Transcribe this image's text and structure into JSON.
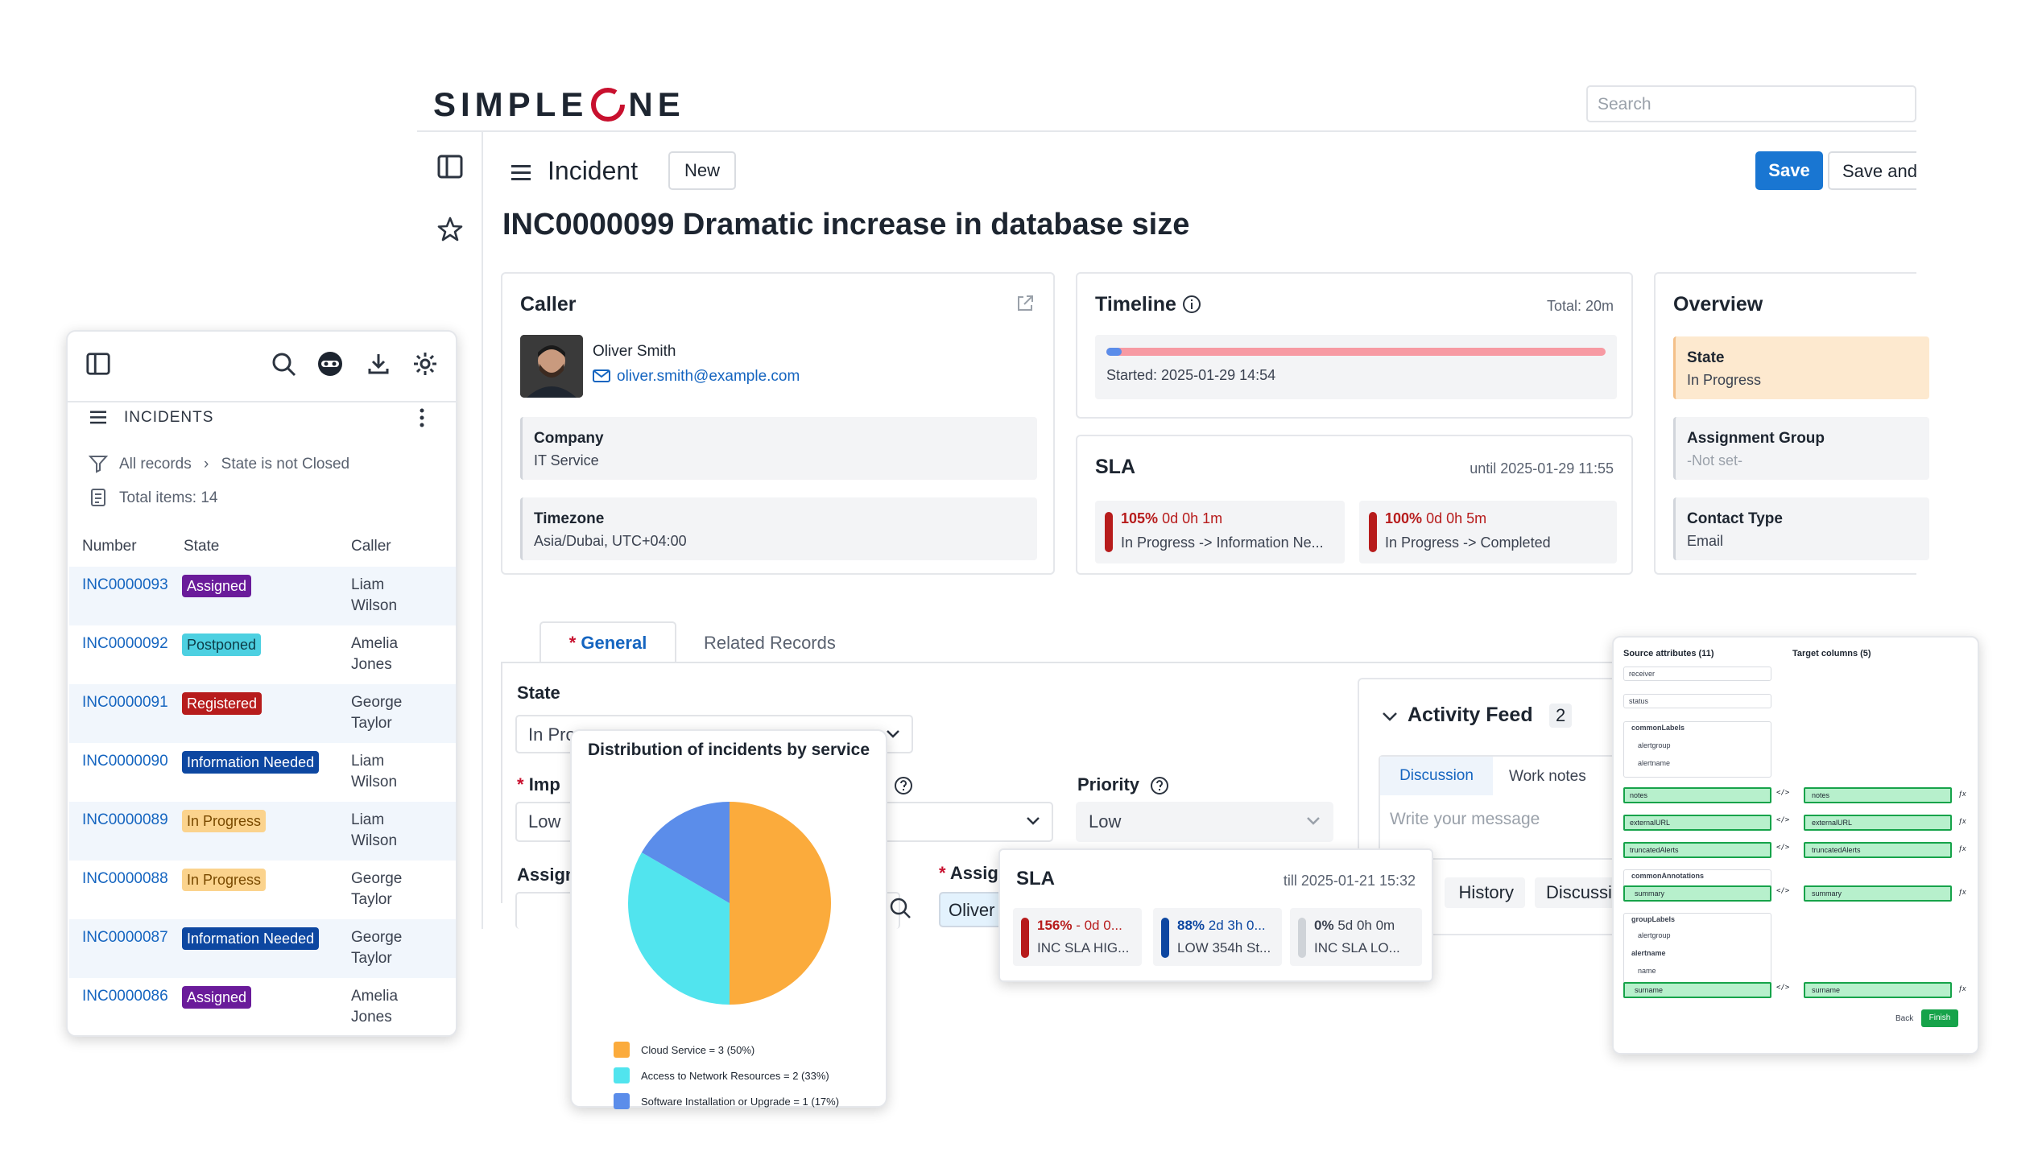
{
  "brand": {
    "logo_left": "SIMPLE",
    "logo_right": "NE",
    "accent": "#c8102e"
  },
  "search": {
    "placeholder": "Search"
  },
  "header": {
    "menu_icon": "hamburger-icon",
    "title": "Incident",
    "new_label": "New",
    "save_label": "Save",
    "save_and_label": "Save and E"
  },
  "record": {
    "title": "INC0000099 Dramatic increase in database size"
  },
  "caller": {
    "heading": "Caller",
    "name": "Oliver Smith",
    "email": "oliver.smith@example.com",
    "company_label": "Company",
    "company_value": "IT Service",
    "timezone_label": "Timezone",
    "timezone_value": "Asia/Dubai, UTC+04:00"
  },
  "timeline": {
    "heading": "Timeline",
    "total": "Total: 20m",
    "started": "Started: 2025-01-29 14:54",
    "progress": 0.03
  },
  "sla": {
    "heading": "SLA",
    "until": "until 2025-01-29 11:55",
    "items": [
      {
        "pct": "105%",
        "time": "0d 0h 1m",
        "desc": "In Progress -> Information Ne..."
      },
      {
        "pct": "100%",
        "time": "0d 0h 5m",
        "desc": "In Progress -> Completed"
      }
    ]
  },
  "overview": {
    "heading": "Overview",
    "state_label": "State",
    "state_value": "In Progress",
    "group_label": "Assignment Group",
    "group_value": "-Not set-",
    "contact_label": "Contact Type",
    "contact_value": "Email"
  },
  "tabs": {
    "general": "General",
    "required_mark": "*",
    "related": "Related Records"
  },
  "form": {
    "state_label": "State",
    "state_value": "In Progress",
    "impact_label": "Imp",
    "impact_value": "Low",
    "priority_label": "Priority",
    "priority_value": "Low",
    "assign_label": "Assign",
    "assigned_label": "Assig",
    "assigned_value": "Oliver"
  },
  "activity": {
    "heading": "Activity Feed",
    "count": "2",
    "tab_discussion": "Discussion",
    "tab_work_notes": "Work notes",
    "placeholder": "Write your message",
    "history": "History",
    "discussion2": "Discussion"
  },
  "list_panel": {
    "title": "INCIDENTS",
    "filter_all": "All records",
    "filter_sep": "›",
    "filter_cond": "State is not Closed",
    "total": "Total items: 14",
    "columns": [
      "Number",
      "State",
      "Caller"
    ],
    "rows": [
      {
        "number": "INC0000093",
        "state": "Assigned",
        "state_bg": "#6a1b9a",
        "state_fg": "#ffffff",
        "caller1": "Liam",
        "caller2": "Wilson"
      },
      {
        "number": "INC0000092",
        "state": "Postponed",
        "state_bg": "#4dd0e1",
        "state_fg": "#0d3c47",
        "caller1": "Amelia",
        "caller2": "Jones"
      },
      {
        "number": "INC0000091",
        "state": "Registered",
        "state_bg": "#b71c1c",
        "state_fg": "#ffffff",
        "caller1": "George",
        "caller2": "Taylor"
      },
      {
        "number": "INC0000090",
        "state": "Information Needed",
        "state_bg": "#0d47a1",
        "state_fg": "#ffffff",
        "caller1": "Liam",
        "caller2": "Wilson"
      },
      {
        "number": "INC0000089",
        "state": "In Progress",
        "state_bg": "#fbd38d",
        "state_fg": "#7a4a00",
        "caller1": "Liam",
        "caller2": "Wilson"
      },
      {
        "number": "INC0000088",
        "state": "In Progress",
        "state_bg": "#fbd38d",
        "state_fg": "#7a4a00",
        "caller1": "George",
        "caller2": "Taylor"
      },
      {
        "number": "INC0000087",
        "state": "Information Needed",
        "state_bg": "#0d47a1",
        "state_fg": "#ffffff",
        "caller1": "George",
        "caller2": "Taylor"
      },
      {
        "number": "INC0000086",
        "state": "Assigned",
        "state_bg": "#6a1b9a",
        "state_fg": "#ffffff",
        "caller1": "Amelia",
        "caller2": "Jones"
      }
    ]
  },
  "chart_data": {
    "type": "pie",
    "title": "Distribution of incidents by service",
    "series": [
      {
        "name": "Cloud Service",
        "value": 3,
        "percent": 50,
        "color": "#fbab3c"
      },
      {
        "name": "Access to Network Resources",
        "value": 2,
        "percent": 33,
        "color": "#51e4ee"
      },
      {
        "name": "Software Installation or Upgrade",
        "value": 1,
        "percent": 17,
        "color": "#5b8dea"
      }
    ],
    "legend": [
      "Cloud Service = 3 (50%)",
      "Access to Network Resources = 2 (33%)",
      "Software Installation or Upgrade = 1 (17%)"
    ]
  },
  "sla_popup": {
    "heading": "SLA",
    "till": "till 2025-01-21 15:32",
    "items": [
      {
        "pct": "156%",
        "time": "- 0d 0...",
        "desc": "INC SLA HIG...",
        "color": "#b71c1c",
        "pct_color": "#b71c1c"
      },
      {
        "pct": "88%",
        "time": "2d 3h 0...",
        "desc": "LOW 354h St...",
        "color": "#0d47a1",
        "pct_color": "#0d47a1"
      },
      {
        "pct": "0%",
        "time": "5d 0h 0m",
        "desc": "INC SLA LO...",
        "color": "#cfd3d8",
        "pct_color": "#3b4250"
      }
    ]
  },
  "mapping": {
    "source_heading": "Source attributes (11)",
    "target_heading": "Target columns (5)",
    "source": [
      "receiver",
      "status",
      "commonLabels",
      "alertgroup",
      "alertname",
      "notes",
      "externalURL",
      "truncatedAlerts",
      "commonAnnotations",
      "summary",
      "groupLabels",
      "alertgroup",
      "alertname",
      "name",
      "surname"
    ],
    "targets": [
      "notes",
      "externalURL",
      "truncatedAlerts",
      "summary",
      "surname"
    ],
    "back": "Back",
    "finish": "Finish"
  }
}
